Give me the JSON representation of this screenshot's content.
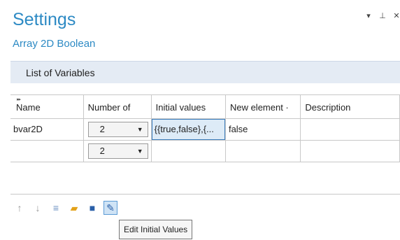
{
  "header": {
    "title": "Settings",
    "subtitle": "Array 2D Boolean",
    "controls": [
      {
        "name": "dropdown-arrow-icon",
        "glyph": "▾"
      },
      {
        "name": "pin-icon",
        "glyph": "⊥"
      },
      {
        "name": "close-icon",
        "glyph": "✕"
      }
    ]
  },
  "section": {
    "label": "List of Variables"
  },
  "table": {
    "sort_glyph": "▸▸",
    "columns": [
      "Name",
      "Number of",
      "Initial values",
      "New element ·",
      "Description"
    ],
    "rows": [
      {
        "name": "bvar2D",
        "number_of": "2",
        "initial_values": "{{true,false},{...",
        "new_element": "false",
        "description": ""
      },
      {
        "name": "",
        "number_of": "2",
        "initial_values": "",
        "new_element": "",
        "description": ""
      }
    ]
  },
  "toolbar": {
    "items": [
      {
        "name": "move-up-icon",
        "glyph": "↑"
      },
      {
        "name": "move-down-icon",
        "glyph": "↓"
      },
      {
        "name": "delete-list-icon",
        "glyph": "≡"
      },
      {
        "name": "open-folder-icon",
        "glyph": "▰"
      },
      {
        "name": "save-icon",
        "glyph": "■"
      },
      {
        "name": "edit-initial-values-icon",
        "glyph": "✎"
      }
    ],
    "tooltip": "Edit Initial Values"
  },
  "colors": {
    "accent": "#2d8ac4",
    "section_bg": "#e4ebf4",
    "selection_bg": "#ddebf7",
    "selection_border": "#3b7dbd"
  }
}
